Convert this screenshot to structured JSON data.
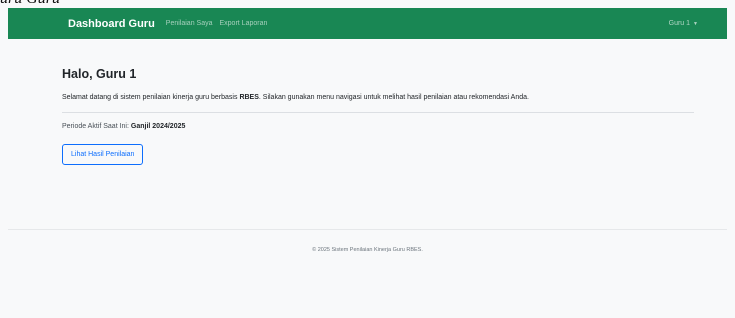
{
  "top_fragment": "uru Guru",
  "navbar": {
    "brand": "Dashboard Guru",
    "links": [
      "Penilaian Saya",
      "Export Laporan"
    ],
    "user_menu": "Guru 1",
    "accent_color": "#198754"
  },
  "main": {
    "greeting": "Halo, Guru 1",
    "welcome_prefix": "Selamat datang di sistem penilaian kinerja guru berbasis ",
    "welcome_bold": "RBES",
    "welcome_suffix": ". Silakan gunakan menu navigasi untuk melihat hasil penilaian atau rekomendasi Anda.",
    "periode_label": "Periode Aktif Saat Ini:",
    "periode_value": "Ganjil 2024/2025",
    "button_label": "Lihat Hasil Penilaian"
  },
  "footer": {
    "text": "© 2025 Sistem Penilaian Kinerja Guru RBES."
  },
  "icons": {
    "user_menu_caret": "caret-down-icon"
  }
}
